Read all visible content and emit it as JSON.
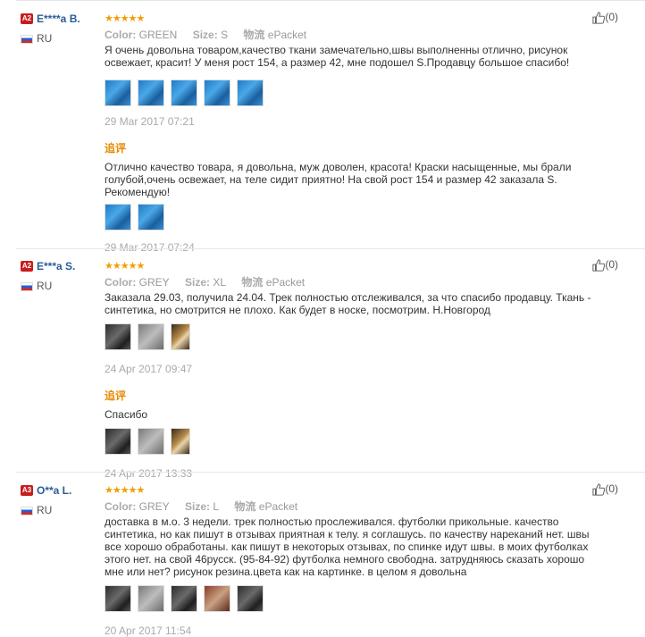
{
  "labels": {
    "color": "Color:",
    "size": "Size:",
    "logistics": "物流",
    "additional": "追评"
  },
  "reviews": [
    {
      "level": "A2",
      "name": "E****a B.",
      "country": "RU",
      "stars": "★★★★★",
      "color": "GREEN",
      "size": "S",
      "shipping": "ePacket",
      "text": "Я очень довольна товаром,качество ткани замечательно,швы выполненны отлично, рисунок освежает, красит! У меня рост 154, а размер 42, мне подошел S.Продавцу большое спасибо!",
      "date": "29 Mar 2017 07:21",
      "followup_text": "Отлично качество товара, я довольна, муж доволен, красота! Краски насыщенные, мы брали голубой,очень освежает, на теле сидит приятно! На свой рост 154 и размер 42 заказала S. Рекомендую!",
      "followup_date": "29 Mar 2017 07:24",
      "likes": "(0)"
    },
    {
      "level": "A2",
      "name": "E***a S.",
      "country": "RU",
      "stars": "★★★★★",
      "color": "GREY",
      "size": "XL",
      "shipping": "ePacket",
      "text": "Заказала 29.03, получила 24.04. Трек полностью отслеживался, за что спасибо продавцу. Ткань - синтетика, но смотрится не плохо. Как будет в носке, посмотрим. Н.Новгород",
      "date": "24 Apr 2017 09:47",
      "followup_text": "Спасибо",
      "followup_date": "24 Apr 2017 13:33",
      "likes": "(0)"
    },
    {
      "level": "A3",
      "name": "O**a L.",
      "country": "RU",
      "stars": "★★★★★",
      "color": "GREY",
      "size": "L",
      "shipping": "ePacket",
      "text": "доставка в м.о. 3 недели. трек полностью прослеживался. футболки прикольные. качество синтетика, но как пишут в отзывах приятная к телу. я соглашусь. по качеству нареканий нет. швы все хорошо обработаны. как пишут в некоторых отзывах, по спинке идут швы. в моих футболках этого нет. на свой 46русск. (95-84-92) футболка немного свободна. затрудняюсь сказать хорошо мне или нет? рисунок резина.цвета как на картинке. в целом я довольна",
      "date": "20 Apr 2017 11:54",
      "likes": "(0)"
    }
  ],
  "icons": {
    "like": "thumbs-up-icon",
    "flag": "russia-flag-icon"
  },
  "colors": {
    "stars": "#f29d00",
    "name": "#2b5b9a",
    "additional": "#e68a00",
    "level": "#c81d1d"
  }
}
